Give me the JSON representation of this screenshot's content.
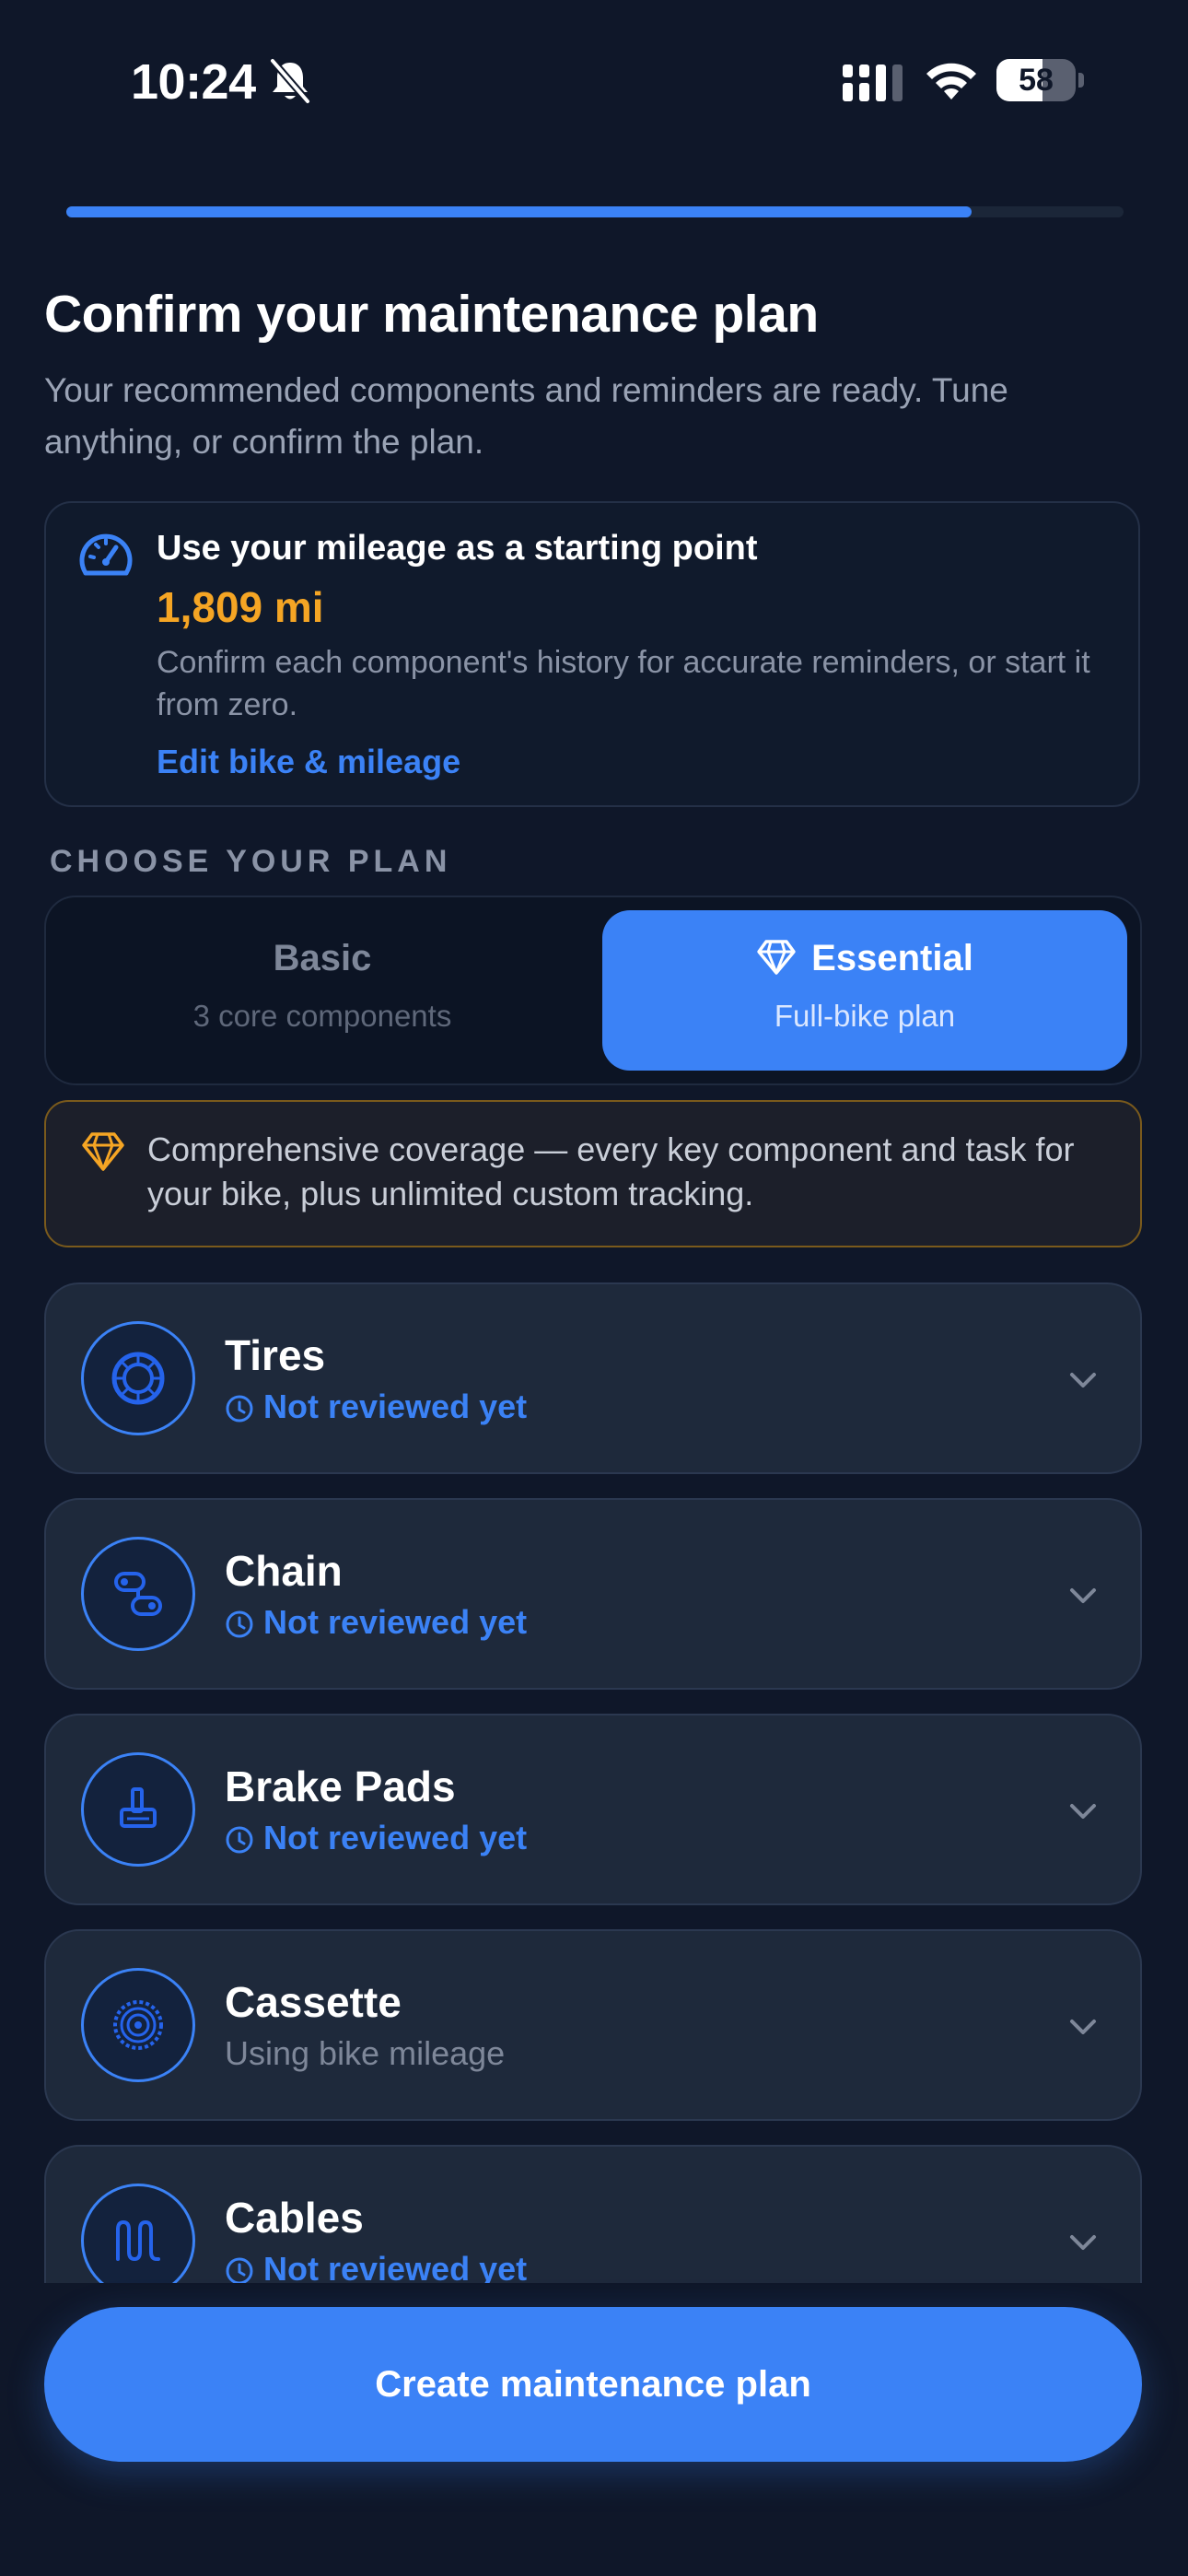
{
  "status_bar": {
    "time": "10:24",
    "battery": "58"
  },
  "progress": {
    "fraction": 0.856
  },
  "header": {
    "title": "Confirm your maintenance plan",
    "subtitle": "Your recommended components and reminders are ready. Tune anything, or confirm the plan."
  },
  "mileage_card": {
    "heading": "Use your mileage as a starting point",
    "value": "1,809 mi",
    "description": "Confirm each component's history for accurate reminders, or start it from zero.",
    "edit_link": "Edit bike & mileage"
  },
  "plan_section": {
    "label": "CHOOSE YOUR PLAN"
  },
  "plans": {
    "basic": {
      "title": "Basic",
      "subtitle": "3 core components"
    },
    "essential": {
      "title": "Essential",
      "subtitle": "Full-bike plan",
      "selected": true
    }
  },
  "banner": {
    "text": "Comprehensive coverage — every key component and task for your bike, plus unlimited custom tracking."
  },
  "components": [
    {
      "name": "Tires",
      "status": "Not reviewed yet",
      "icon": "tire-icon"
    },
    {
      "name": "Chain",
      "status": "Not reviewed yet",
      "icon": "chain-icon"
    },
    {
      "name": "Brake Pads",
      "status": "Not reviewed yet",
      "icon": "brake-pad-icon"
    },
    {
      "name": "Cassette",
      "status": "Using bike mileage",
      "icon": "cassette-icon"
    },
    {
      "name": "Cables",
      "status": "Not reviewed yet",
      "icon": "cable-icon"
    }
  ],
  "cta": {
    "label": "Create maintenance plan"
  },
  "colors": {
    "accent": "#3b82f6",
    "highlight": "#f5a524",
    "background": "#0f1729",
    "card": "#1e293b"
  }
}
